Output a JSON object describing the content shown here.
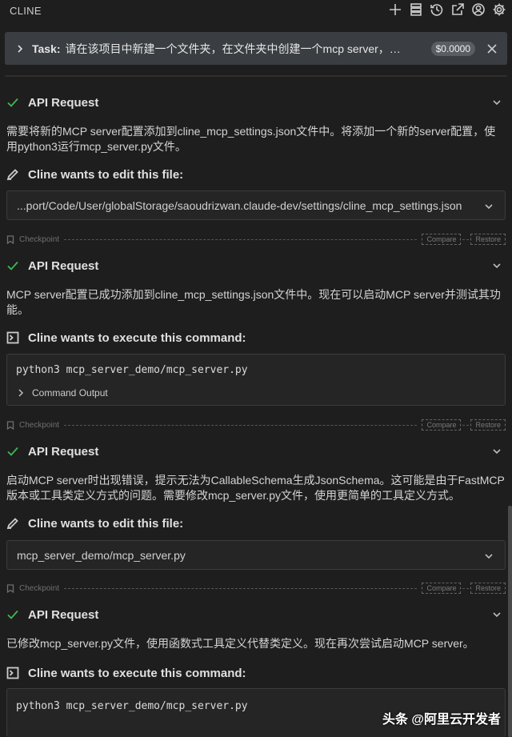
{
  "header": {
    "title": "CLINE"
  },
  "task": {
    "label": "Task:",
    "text": "请在该项目中新建一个文件夹，在文件夹中创建一个mcp server，你需…",
    "cost": "$0.0000"
  },
  "items": {
    "api1": {
      "label": "API Request"
    },
    "msg1": "需要将新的MCP server配置添加到cline_mcp_settings.json文件中。将添加一个新的server配置，使用python3运行mcp_server.py文件。",
    "edit1": {
      "label": "Cline wants to edit this file:",
      "path": "...port/Code/User/globalStorage/saoudrizwan.claude-dev/settings/cline_mcp_settings.json"
    },
    "api2": {
      "label": "API Request"
    },
    "msg2": "MCP server配置已成功添加到cline_mcp_settings.json文件中。现在可以启动MCP server并测试其功能。",
    "exec1": {
      "label": "Cline wants to execute this command:",
      "command": "python3 mcp_server_demo/mcp_server.py",
      "output_label": "Command Output"
    },
    "api3": {
      "label": "API Request"
    },
    "msg3": "启动MCP server时出现错误，提示无法为CallableSchema生成JsonSchema。这可能是由于FastMCP版本或工具类定义方式的问题。需要修改mcp_server.py文件，使用更简单的工具定义方式。",
    "edit2": {
      "label": "Cline wants to edit this file:",
      "path": "mcp_server_demo/mcp_server.py"
    },
    "api4": {
      "label": "API Request"
    },
    "msg4": "已修改mcp_server.py文件，使用函数式工具定义代替类定义。现在再次尝试启动MCP server。",
    "exec2": {
      "label": "Cline wants to execute this command:",
      "command": "python3 mcp_server_demo/mcp_server.py"
    }
  },
  "checkpoint": {
    "label": "Checkpoint",
    "compare": "Compare",
    "restore": "Restore"
  },
  "watermark": "头条 @阿里云开发者",
  "colors": {
    "check": "#3fb950",
    "background": "#1e1e1e",
    "banner": "#3a3d41"
  }
}
